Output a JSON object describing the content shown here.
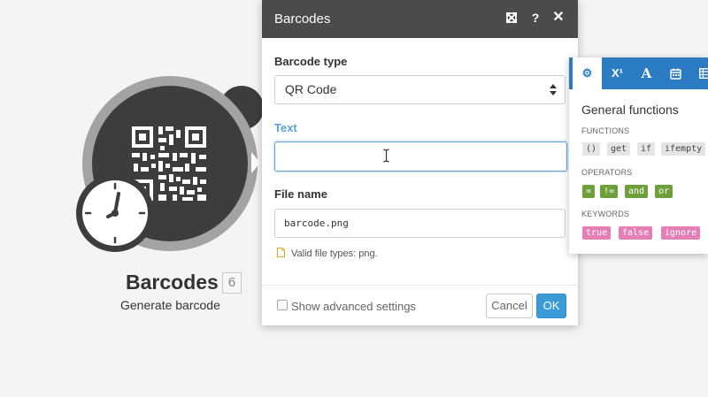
{
  "module": {
    "title": "Barcodes",
    "count": "6",
    "subtitle": "Generate barcode"
  },
  "dialog": {
    "title": "Barcodes",
    "barcode_type_label": "Barcode type",
    "barcode_type_value": "QR Code",
    "text_label": "Text",
    "text_value": "",
    "file_name_label": "File name",
    "file_name_value": "barcode.png",
    "file_hint": "Valid file types: png.",
    "advanced_label": "Show advanced settings",
    "cancel_label": "Cancel",
    "ok_label": "OK"
  },
  "functions_panel": {
    "tabs": [
      {
        "icon": "gear-icon",
        "glyph": "⚙"
      },
      {
        "icon": "math-superscript-icon",
        "glyph": "X¹"
      },
      {
        "icon": "text-icon",
        "glyph": "A"
      },
      {
        "icon": "calendar-icon",
        "glyph": ""
      },
      {
        "icon": "table-icon",
        "glyph": ""
      }
    ],
    "title": "General functions",
    "functions_label": "FUNCTIONS",
    "functions": [
      "()",
      "get",
      "if",
      "ifempty"
    ],
    "operators_label": "OPERATORS",
    "operators": [
      "=",
      "!=",
      "and",
      "or"
    ],
    "keywords_label": "KEYWORDS",
    "keywords": [
      "true",
      "false",
      "ignore"
    ]
  },
  "colors": {
    "header_bg": "#4b4b4b",
    "accent_blue": "#3a9bd6",
    "panel_tab_bg": "#2b7cc2",
    "operator_green": "#6da03a",
    "keyword_pink": "#e57fb6",
    "module_dark": "#3d3d3d",
    "module_ring": "#a3a3a3"
  }
}
